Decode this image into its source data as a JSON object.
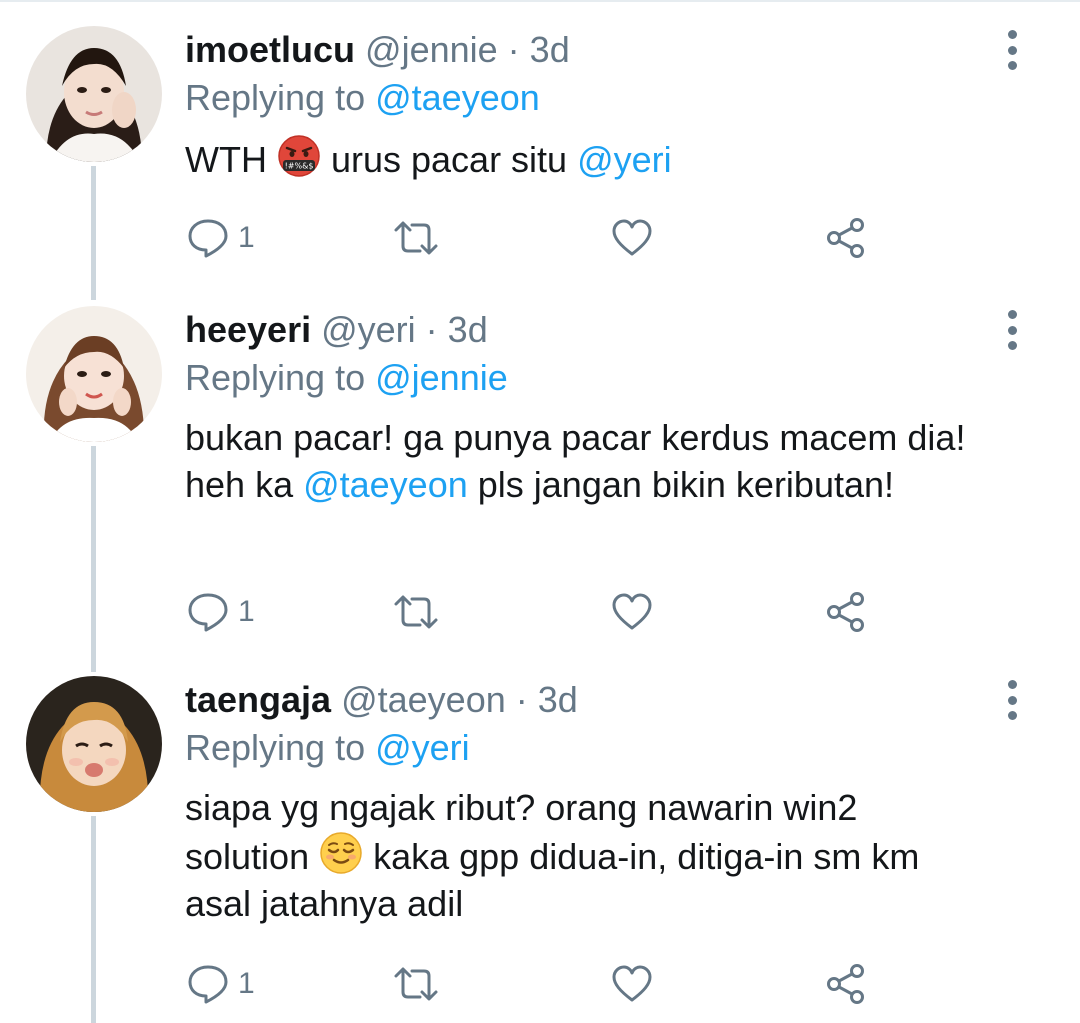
{
  "tweets": [
    {
      "name": "imoetlucu",
      "handle": "@jennie",
      "time": "3d",
      "replying_prefix": "Replying to ",
      "replying_handle": "@taeyeon",
      "text_before": "WTH ",
      "emoji": "face-with-symbols-on-mouth",
      "text_mid": " urus pacar situ ",
      "mention": "@yeri",
      "reply_count": "1"
    },
    {
      "name": "heeyeri",
      "handle": "@yeri",
      "time": "3d",
      "replying_prefix": "Replying to ",
      "replying_handle": "@jennie",
      "line1": "bukan pacar! ga punya pacar kerdus macem dia!",
      "line2_before": "heh ka ",
      "mention": "@taeyeon",
      "line2_after": " pls jangan bikin keributan!",
      "reply_count": "1"
    },
    {
      "name": "taengaja",
      "handle": "@taeyeon",
      "time": "3d",
      "replying_prefix": "Replying to ",
      "replying_handle": "@yeri",
      "line1": "siapa yg ngajak ribut? orang nawarin win2",
      "line2_before": "solution ",
      "emoji": "relieved-face",
      "line2_after": " kaka gpp didua-in, ditiga-in sm km",
      "line3": "asal jatahnya adil",
      "reply_count": "1"
    }
  ],
  "separator": " · ",
  "colors": {
    "link": "#1da1f2",
    "muted": "#657786",
    "text": "#14171a",
    "thread_line": "#ccd6dd"
  },
  "icons": [
    "reply-icon",
    "retweet-icon",
    "like-icon",
    "share-icon",
    "more-options-icon"
  ]
}
